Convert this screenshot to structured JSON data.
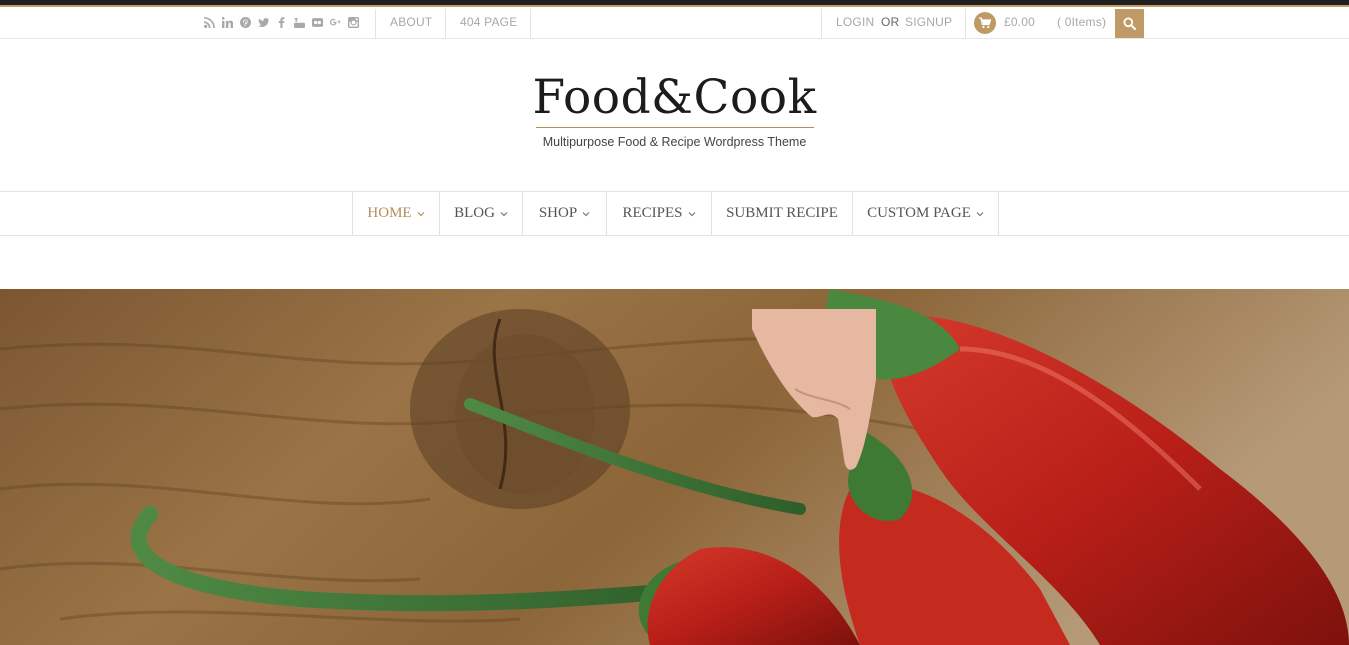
{
  "topbar": {
    "social_icons": [
      "rss-icon",
      "linkedin-icon",
      "pinterest-icon",
      "twitter-icon",
      "facebook-icon",
      "youtube-icon",
      "flickr-icon",
      "google-plus-icon",
      "instagram-icon"
    ],
    "links": [
      "ABOUT",
      "404 PAGE"
    ],
    "login": "LOGIN",
    "or": "OR",
    "signup": "SIGNUP",
    "cart_total": "£0.00",
    "cart_items": "( 0Items)"
  },
  "brand": {
    "title": "Food&Cook",
    "tagline": "Multipurpose Food & Recipe Wordpress Theme"
  },
  "nav": {
    "items": [
      {
        "label": "HOME",
        "active": true,
        "dropdown": true
      },
      {
        "label": "BLOG",
        "dropdown": true
      },
      {
        "label": "SHOP",
        "dropdown": true
      },
      {
        "label": "RECIPES",
        "dropdown": true
      },
      {
        "label": "SUBMIT RECIPE",
        "dropdown": false
      },
      {
        "label": "CUSTOM PAGE",
        "dropdown": true
      }
    ]
  },
  "colors": {
    "accent": "#c09a66",
    "top_stripe": "#1f1f1f"
  }
}
